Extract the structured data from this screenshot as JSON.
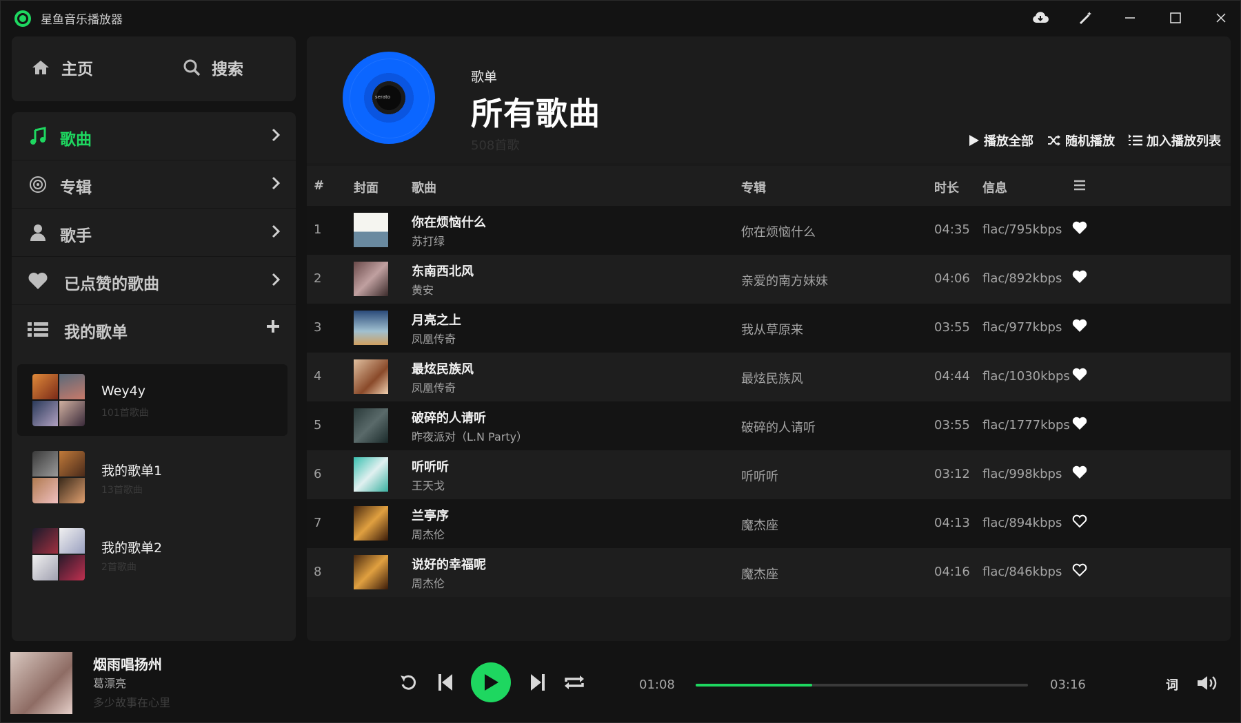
{
  "app": {
    "title": "星鱼音乐播放器"
  },
  "nav": {
    "home": "主页",
    "search": "搜索"
  },
  "library": {
    "items": [
      {
        "label": "歌曲",
        "icon": "music-note-icon",
        "active": true
      },
      {
        "label": "专辑",
        "icon": "disc-icon",
        "active": false
      },
      {
        "label": "歌手",
        "icon": "user-icon",
        "active": false
      },
      {
        "label": "已点赞的歌曲",
        "icon": "heart-icon",
        "active": false
      }
    ],
    "playlists_header": "我的歌单",
    "playlists": [
      {
        "name": "Wey4y",
        "count": "101首歌曲",
        "active": true
      },
      {
        "name": "我的歌单1",
        "count": "13首歌曲",
        "active": false
      },
      {
        "name": "我的歌单2",
        "count": "2首歌曲",
        "active": false
      }
    ]
  },
  "header": {
    "subtitle": "歌单",
    "title": "所有歌曲",
    "count": "508首歌",
    "vinyl_label": "serato",
    "actions": {
      "play_all": "播放全部",
      "shuffle": "随机播放",
      "add_to_queue": "加入播放列表"
    }
  },
  "table": {
    "columns": {
      "index": "#",
      "cover": "封面",
      "song": "歌曲",
      "album": "专辑",
      "duration": "时长",
      "info": "信息"
    },
    "rows": [
      {
        "index": "1",
        "title": "你在烦恼什么",
        "artist": "苏打绿",
        "album": "你在烦恼什么",
        "duration": "04:35",
        "info": "flac/795kbps",
        "liked": true
      },
      {
        "index": "2",
        "title": "东南西北风",
        "artist": "黄安",
        "album": "亲爱的南方妹妹",
        "duration": "04:06",
        "info": "flac/892kbps",
        "liked": true
      },
      {
        "index": "3",
        "title": "月亮之上",
        "artist": "凤凰传奇",
        "album": "我从草原来",
        "duration": "03:55",
        "info": "flac/977kbps",
        "liked": true
      },
      {
        "index": "4",
        "title": "最炫民族风",
        "artist": "凤凰传奇",
        "album": "最炫民族风",
        "duration": "04:44",
        "info": "flac/1030kbps",
        "liked": true
      },
      {
        "index": "5",
        "title": "破碎的人请听",
        "artist": "昨夜派对（L.N Party）",
        "album": "破碎的人请听",
        "duration": "03:55",
        "info": "flac/1777kbps",
        "liked": true
      },
      {
        "index": "6",
        "title": "听听听",
        "artist": "王天戈",
        "album": "听听听",
        "duration": "03:12",
        "info": "flac/998kbps",
        "liked": true
      },
      {
        "index": "7",
        "title": "兰亭序",
        "artist": "周杰伦",
        "album": "魔杰座",
        "duration": "04:13",
        "info": "flac/894kbps",
        "liked": false
      },
      {
        "index": "8",
        "title": "说好的幸福呢",
        "artist": "周杰伦",
        "album": "魔杰座",
        "duration": "04:16",
        "info": "flac/846kbps",
        "liked": false
      }
    ]
  },
  "player": {
    "title": "烟雨唱扬州",
    "artist": "葛漂亮",
    "lyric": "多少故事在心里",
    "current_time": "01:08",
    "total_time": "03:16",
    "progress_fraction": 0.35,
    "lyrics_button": "词"
  },
  "colors": {
    "accent": "#1ed760",
    "background": "#131313",
    "panel": "#1e1e1e"
  }
}
